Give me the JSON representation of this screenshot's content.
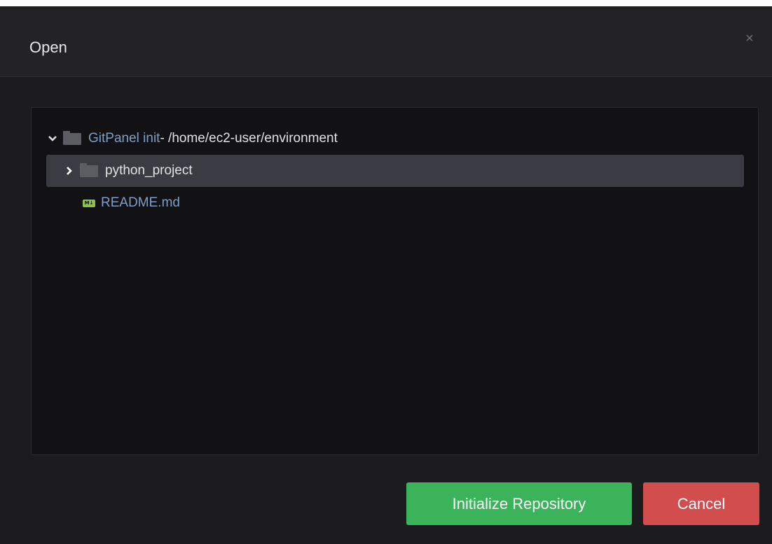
{
  "dialog": {
    "title": "Open",
    "close_glyph": "×"
  },
  "tree": {
    "root": {
      "name": "GitPanel init",
      "path": " - /home/ec2-user/environment",
      "expanded": true,
      "icon": "folder-icon",
      "toggle_icon": "chevron-down-icon"
    },
    "items": [
      {
        "name": "python_project",
        "type": "folder",
        "expanded": false,
        "selected": true,
        "icon": "folder-icon",
        "toggle_icon": "chevron-right-icon"
      },
      {
        "name": "README.md",
        "type": "file",
        "icon": "markdown-file-icon",
        "icon_label": "M↓"
      }
    ]
  },
  "buttons": {
    "initialize_label": "Initialize Repository",
    "cancel_label": "Cancel"
  },
  "colors": {
    "primary": "#3bb35a",
    "danger": "#d24d4d",
    "selected_row": "#3b3b44",
    "link_text": "#7d9fc7",
    "markdown_icon": "#8dc149"
  }
}
